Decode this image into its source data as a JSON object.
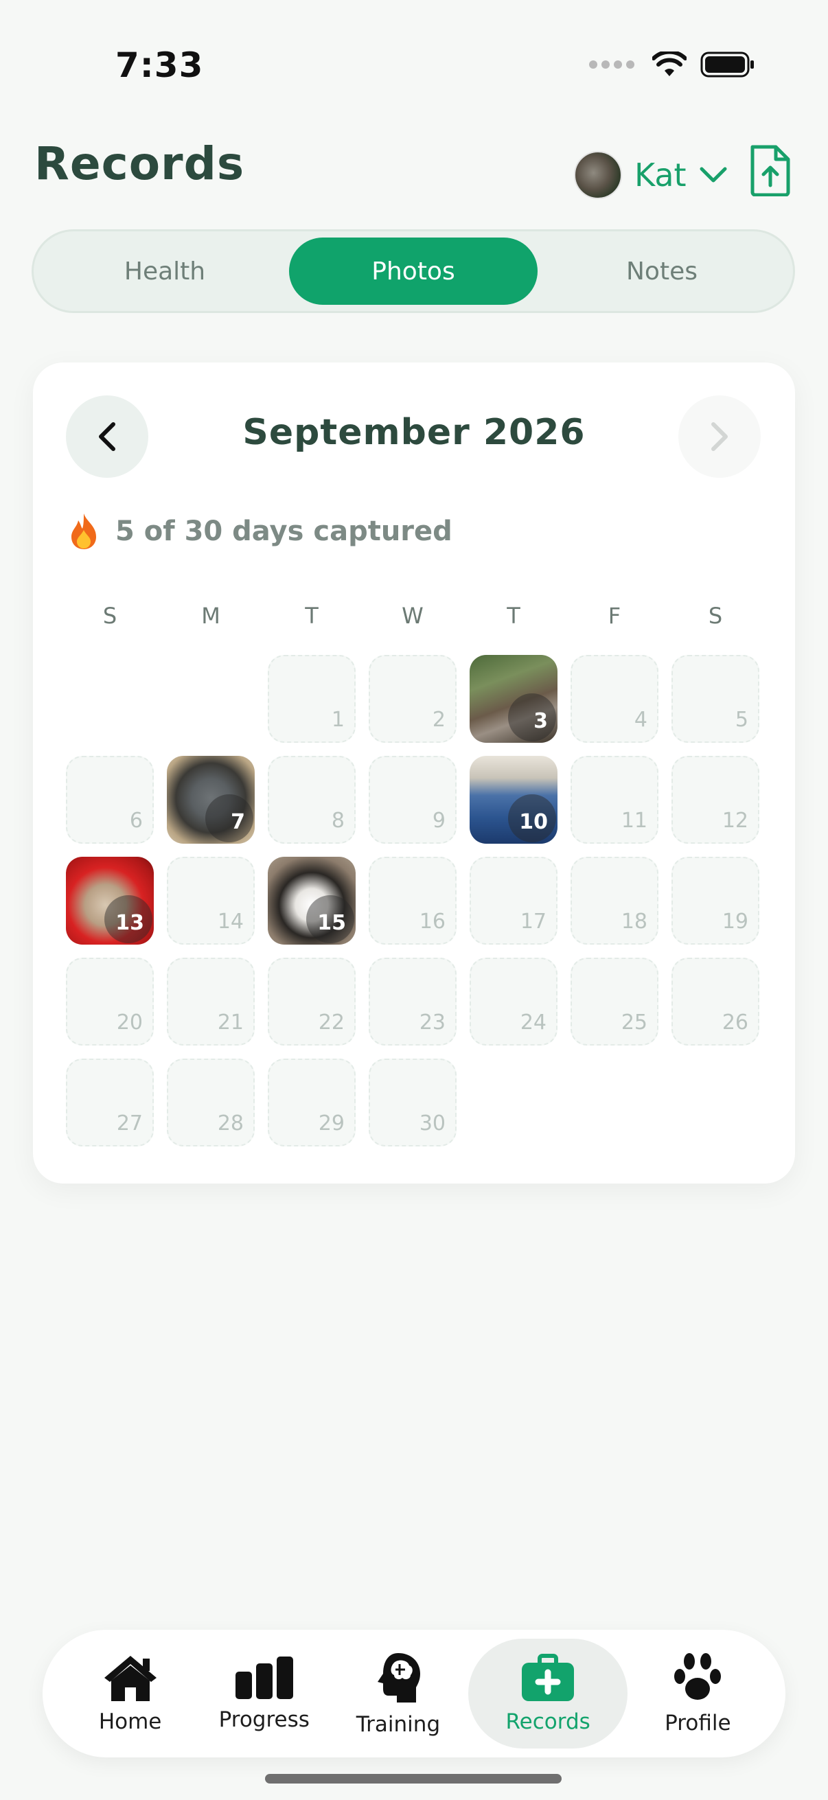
{
  "status_bar": {
    "time": "7:33"
  },
  "header": {
    "title": "Records",
    "pet_name": "Kat"
  },
  "tabs": [
    {
      "label": "Health",
      "active": false
    },
    {
      "label": "Photos",
      "active": true
    },
    {
      "label": "Notes",
      "active": false
    }
  ],
  "calendar": {
    "month_label": "September 2026",
    "streak_text": "5 of 30 days captured",
    "weekdays": [
      "S",
      "M",
      "T",
      "W",
      "T",
      "F",
      "S"
    ],
    "days": [
      "",
      "",
      "1",
      "2",
      "3",
      "4",
      "5",
      "6",
      "7",
      "8",
      "9",
      "10",
      "11",
      "12",
      "13",
      "14",
      "15",
      "16",
      "17",
      "18",
      "19",
      "20",
      "21",
      "22",
      "23",
      "24",
      "25",
      "26",
      "27",
      "28",
      "29",
      "30"
    ],
    "photo_days": [
      "3",
      "7",
      "10",
      "13",
      "15"
    ]
  },
  "bottom_nav": [
    {
      "label": "Home",
      "icon": "home-icon",
      "active": false
    },
    {
      "label": "Progress",
      "icon": "bar-chart-icon",
      "active": false
    },
    {
      "label": "Training",
      "icon": "brain-head-icon",
      "active": false
    },
    {
      "label": "Records",
      "icon": "medical-kit-icon",
      "active": true
    },
    {
      "label": "Profile",
      "icon": "paw-icon",
      "active": false
    }
  ],
  "colors": {
    "accent": "#10a36b",
    "title": "#2c4a3e",
    "background": "#f6f8f6"
  }
}
